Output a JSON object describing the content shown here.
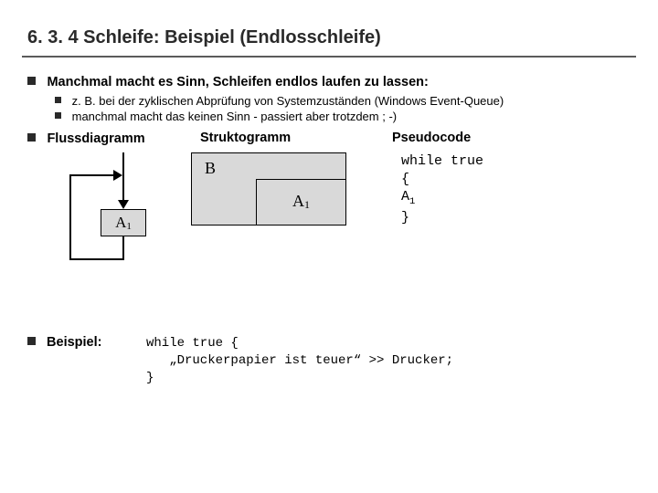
{
  "slide": {
    "title": "6. 3. 4  Schleife: Beispiel (Endlosschleife)",
    "bullet1": "Manchmal macht es Sinn, Schleifen endlos laufen zu lassen:",
    "sub1": "z. B. bei der zyklischen Abprüfung von Systemzuständen (Windows Event-Queue)",
    "sub2": "manchmal macht das keinen Sinn - passiert aber trotzdem ; -)",
    "heads": {
      "flow": "Flussdiagramm",
      "strukt": "Struktogramm",
      "pseudo": "Pseudocode"
    },
    "box": {
      "A": "A",
      "A_sub": "1",
      "B": "B"
    },
    "pseudo": {
      "l1": "while true",
      "l2": "{",
      "l3": "   A",
      "l3sub": "1",
      "l4": "}"
    },
    "example": {
      "label": "Beispiel:",
      "code": "while true {\n   „Druckerpapier ist teuer“ >> Drucker;\n}"
    }
  }
}
